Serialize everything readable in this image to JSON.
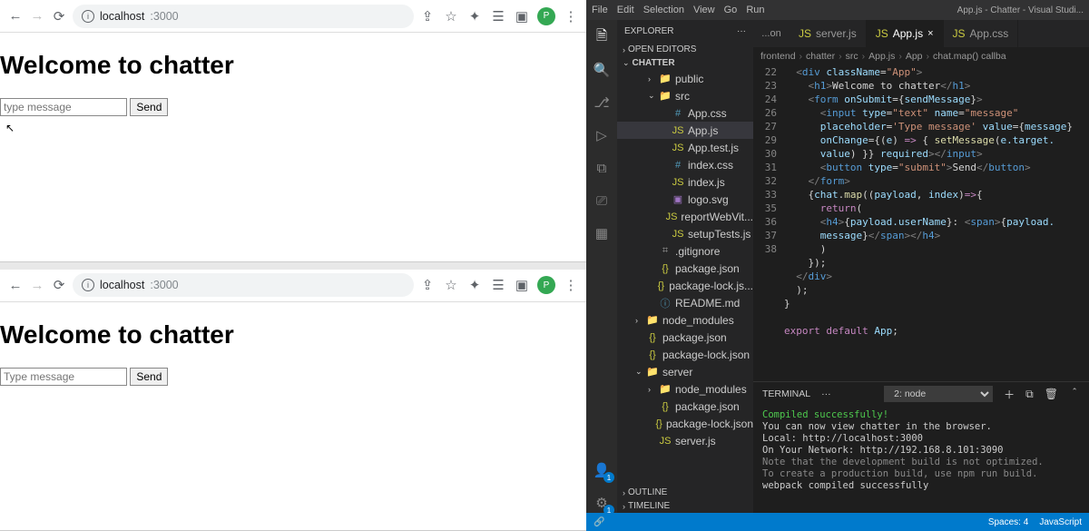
{
  "browser_top": {
    "url_domain": "localhost",
    "url_path": ":3000",
    "heading": "Welcome to chatter",
    "placeholder": "type message",
    "send": "Send",
    "avatar_letter": "P"
  },
  "browser_bottom": {
    "url_domain": "localhost",
    "url_path": ":3000",
    "heading": "Welcome to chatter",
    "placeholder": "Type message",
    "send": "Send",
    "avatar_letter": "P"
  },
  "vscode": {
    "menubar": [
      "File",
      "Edit",
      "Selection",
      "View",
      "Go",
      "Run"
    ],
    "title": "App.js - Chatter - Visual Studi...",
    "explorer_label": "EXPLORER",
    "open_editors": "OPEN EDITORS",
    "root": "CHATTER",
    "outline": "OUTLINE",
    "timeline": "TIMELINE",
    "tree": [
      {
        "l": "public",
        "d": 2,
        "t": "folder",
        "chev": "›"
      },
      {
        "l": "src",
        "d": 2,
        "t": "folder",
        "chev": "⌄"
      },
      {
        "l": "App.css",
        "d": 3,
        "t": "css"
      },
      {
        "l": "App.js",
        "d": 3,
        "t": "js",
        "sel": true
      },
      {
        "l": "App.test.js",
        "d": 3,
        "t": "js"
      },
      {
        "l": "index.css",
        "d": 3,
        "t": "css"
      },
      {
        "l": "index.js",
        "d": 3,
        "t": "js"
      },
      {
        "l": "logo.svg",
        "d": 3,
        "t": "svg"
      },
      {
        "l": "reportWebVit...",
        "d": 3,
        "t": "js"
      },
      {
        "l": "setupTests.js",
        "d": 3,
        "t": "js"
      },
      {
        "l": ".gitignore",
        "d": 2,
        "t": "txt"
      },
      {
        "l": "package.json",
        "d": 2,
        "t": "json"
      },
      {
        "l": "package-lock.js...",
        "d": 2,
        "t": "json"
      },
      {
        "l": "README.md",
        "d": 2,
        "t": "md"
      },
      {
        "l": "node_modules",
        "d": 1,
        "t": "folder",
        "chev": "›"
      },
      {
        "l": "package.json",
        "d": 1,
        "t": "json"
      },
      {
        "l": "package-lock.json",
        "d": 1,
        "t": "json"
      },
      {
        "l": "server",
        "d": 1,
        "t": "folder",
        "chev": "⌄"
      },
      {
        "l": "node_modules",
        "d": 2,
        "t": "folder",
        "chev": "›"
      },
      {
        "l": "package.json",
        "d": 2,
        "t": "json"
      },
      {
        "l": "package-lock.json",
        "d": 2,
        "t": "json"
      },
      {
        "l": "server.js",
        "d": 2,
        "t": "js"
      }
    ],
    "tabs": [
      {
        "label": "server.js",
        "active": false
      },
      {
        "label": "App.js",
        "active": true,
        "close": true
      },
      {
        "label": "App.css",
        "active": false
      }
    ],
    "tab_extra": "...on",
    "breadcrumbs": [
      "frontend",
      "chatter",
      "src",
      "App.js",
      "App",
      "chat.map() callba"
    ],
    "gutter": [
      "22",
      "23",
      "24",
      "",
      "",
      "",
      "26",
      "27",
      "",
      "29",
      "30",
      "",
      "31",
      "32",
      "33",
      "35",
      "36",
      "37",
      "38"
    ],
    "terminal": {
      "label": "TERMINAL",
      "select": "2: node",
      "lines": [
        {
          "cls": "t-green",
          "text": "Compiled successfully!"
        },
        {
          "cls": "",
          "text": ""
        },
        {
          "cls": "",
          "text": "You can now view chatter in the browser."
        },
        {
          "cls": "",
          "text": ""
        },
        {
          "cls": "",
          "text": "   Local:            http://localhost:3000"
        },
        {
          "cls": "",
          "text": "   On Your Network:  http://192.168.8.101:3090"
        },
        {
          "cls": "",
          "text": ""
        },
        {
          "cls": "t-dim",
          "text": "Note that the development build is not optimized."
        },
        {
          "cls": "t-dim",
          "text": "To create a production build, use npm run build."
        },
        {
          "cls": "",
          "text": ""
        },
        {
          "cls": "t-dim2",
          "text": "webpack compiled successfully"
        }
      ]
    },
    "status": {
      "left": "🔗",
      "spaces": "Spaces: 4",
      "lang": "JavaScript"
    }
  }
}
